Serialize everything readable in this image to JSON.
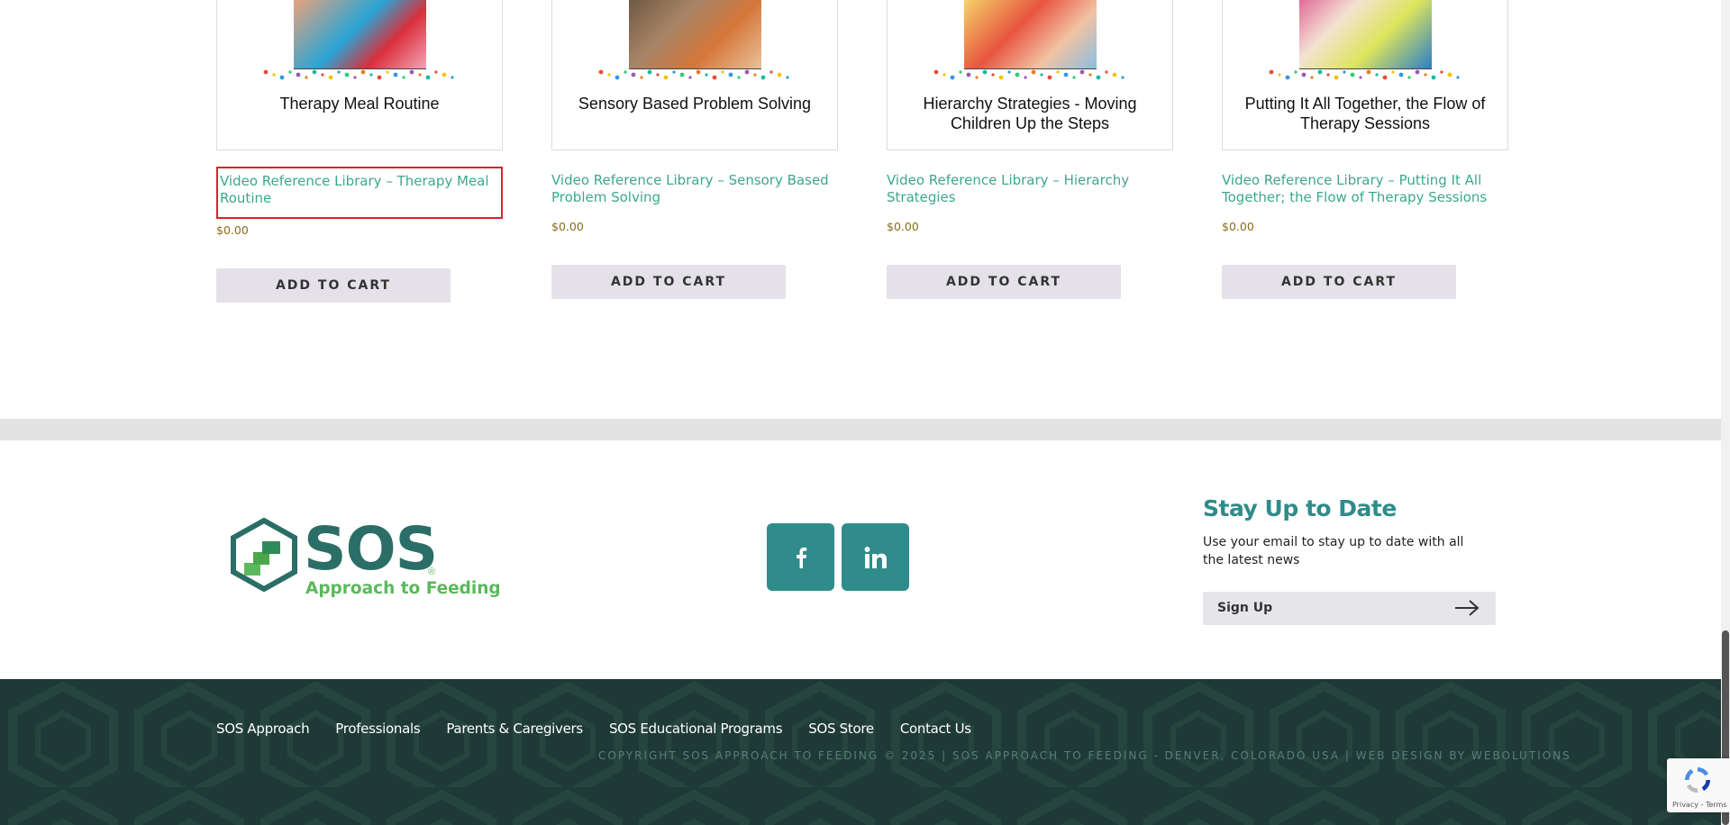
{
  "products": [
    {
      "card_title": "Therapy Meal Routine",
      "link": "Video Reference Library – Therapy Meal Routine",
      "price": "$0.00",
      "button": "ADD TO CART",
      "thumb_colors": [
        "#2aa4d6",
        "#d9303a",
        "#f4a3b8"
      ]
    },
    {
      "card_title": "Sensory Based Problem Solving",
      "link": "Video Reference Library – Sensory Based Problem Solving",
      "price": "$0.00",
      "button": "ADD TO CART",
      "thumb_colors": [
        "#6e5a44",
        "#d6773a",
        "#e8c29a"
      ]
    },
    {
      "card_title": "Hierarchy Strategies - Moving Children Up the Steps",
      "link": "Video Reference Library – Hierarchy Strategies",
      "price": "$0.00",
      "button": "ADD TO CART",
      "thumb_colors": [
        "#f5d36a",
        "#e7553e",
        "#8ac0e0"
      ]
    },
    {
      "card_title": "Putting It All Together, the Flow of Therapy Sessions",
      "link": "Video Reference Library – Putting It All Together; the Flow of Therapy Sessions",
      "price": "$0.00",
      "button": "ADD TO CART",
      "thumb_colors": [
        "#dde55b",
        "#e06b9a",
        "#2a7fc8"
      ]
    }
  ],
  "footer": {
    "logo": {
      "word": "SOS",
      "sub": "Approach to Feeding",
      "reg": "®"
    },
    "social": [
      {
        "name": "facebook",
        "glyph": "f"
      },
      {
        "name": "linkedin",
        "glyph": "in"
      }
    ],
    "stay_title": "Stay Up to Date",
    "stay_text": "Use your email to stay up to date with all the latest news",
    "signup_label": "Sign Up"
  },
  "bottom": {
    "nav": [
      "SOS Approach",
      "Professionals",
      "Parents & Caregivers",
      "SOS Educational Programs",
      "SOS Store",
      "Contact Us"
    ],
    "copyright": "COPYRIGHT SOS APPROACH TO FEEDING © 2025 | SOS APPROACH TO FEEDING - DENVER, COLORADO USA | WEB DESIGN BY WEBOLUTIONS"
  },
  "recaptcha": {
    "links": "Privacy - Terms"
  },
  "colors": {
    "accent": "#2f8c8a",
    "link": "#3ca88c",
    "price": "#8a6d1a",
    "footer_dark": "#1f3a36",
    "logo_green": "#5cb85c"
  }
}
